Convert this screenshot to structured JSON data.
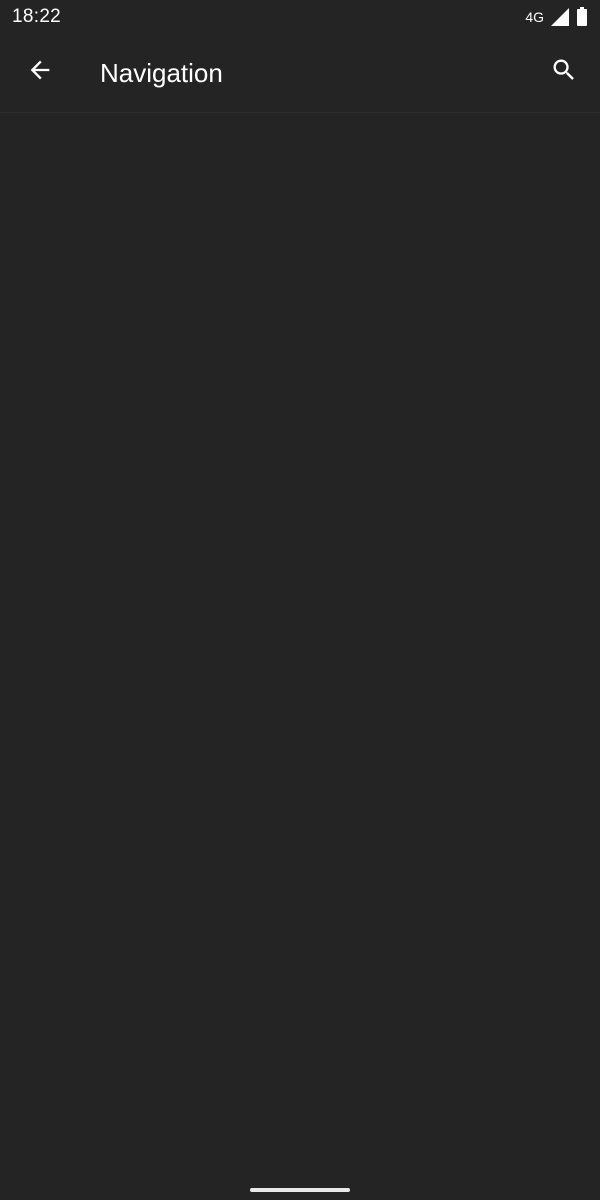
{
  "status_bar": {
    "time": "18:22",
    "network": "4G",
    "icons": [
      "signal-icon",
      "battery-icon"
    ]
  },
  "app_bar": {
    "title": "Navigation",
    "back_icon": "arrow-back-icon",
    "search_icon": "search-icon"
  },
  "colors": {
    "background": "#242424",
    "text": "#ffffff"
  }
}
